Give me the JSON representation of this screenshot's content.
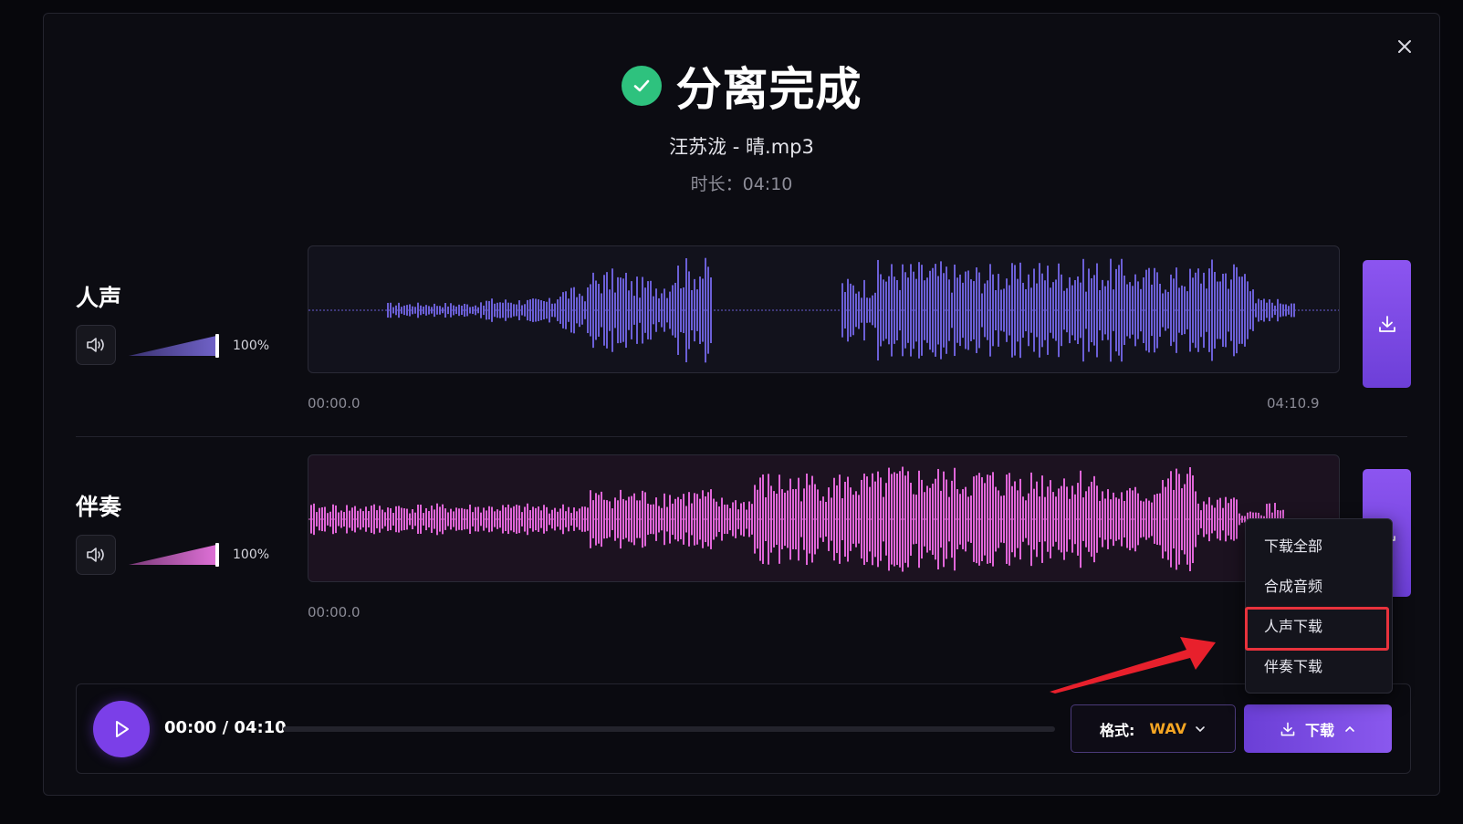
{
  "header": {
    "title": "分离完成",
    "filename": "汪苏泷 - 晴.mp3",
    "duration": "时长：04:10"
  },
  "tracks": [
    {
      "label": "人声",
      "volume": "100%",
      "volume_level": 1.0,
      "start_time": "00:00.0",
      "end_time": "04:10.9",
      "color": "#6b5fd6",
      "fill_from": "#3a3270",
      "fill_to": "#7062c8"
    },
    {
      "label": "伴奏",
      "volume": "100%",
      "volume_level": 1.0,
      "start_time": "00:00.0",
      "color": "#e066d8",
      "fill_from": "#7a3a78",
      "fill_to": "#de70d6"
    }
  ],
  "player": {
    "time": "00:00 / 04:10",
    "progress": 0,
    "format_label": "格式:",
    "format_value": "WAV",
    "download_label": "下载"
  },
  "download_menu": {
    "items": [
      "下载全部",
      "合成音频",
      "人声下载",
      "伴奏下载"
    ]
  },
  "colors": {
    "accent": "#7b3fe8",
    "success": "#2ec27e",
    "format_value": "#f5a623",
    "highlight_box": "#e8323c"
  }
}
